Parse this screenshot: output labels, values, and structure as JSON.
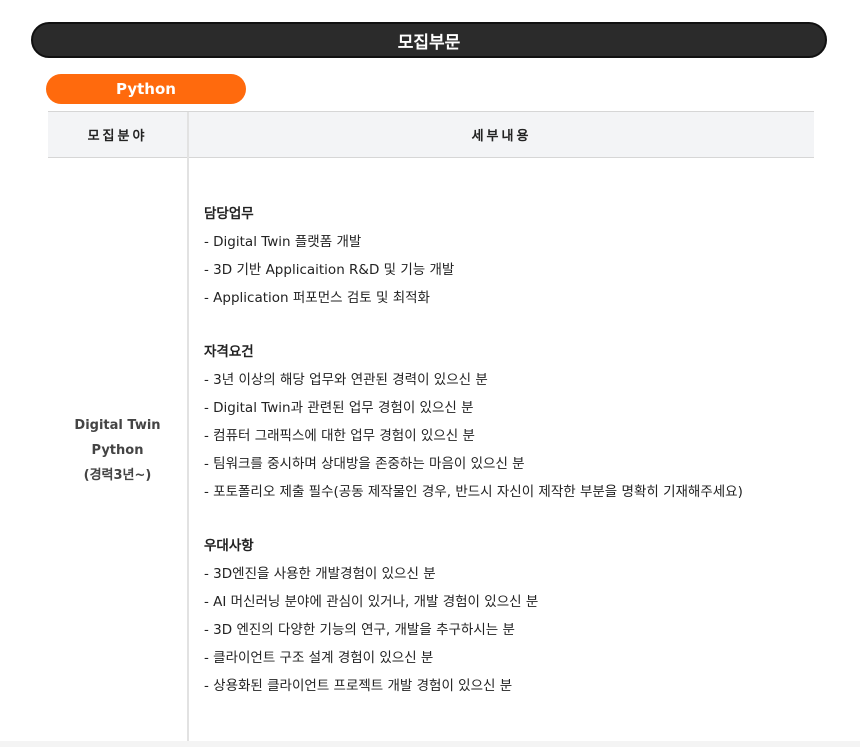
{
  "header": {
    "title": "모집부문"
  },
  "category_pill": {
    "label": "Python"
  },
  "table": {
    "columns": [
      "모집분야",
      "세부내용"
    ],
    "field_lines": [
      "Digital Twin",
      "Python",
      "(경력3년~)"
    ],
    "sections": [
      {
        "title": "담당업무",
        "items": [
          "- Digital Twin 플랫폼 개발",
          "- 3D 기반 Applicaition R&D 및 기능 개발",
          "- Application 퍼포먼스 검토 및 최적화"
        ]
      },
      {
        "title": "자격요건",
        "items": [
          "- 3년 이상의 해당 업무와 연관된 경력이 있으신 분",
          "- Digital Twin과 관련된 업무 경험이 있으신 분",
          "- 컴퓨터 그래픽스에 대한 업무 경험이 있으신 분",
          "- 팀워크를 중시하며 상대방을 존중하는 마음이 있으신 분",
          "- 포토폴리오 제출 필수(공동 제작물인 경우, 반드시 자신이 제작한 부분을 명확히 기재해주세요)"
        ]
      },
      {
        "title": "우대사항",
        "items": [
          "- 3D엔진을 사용한 개발경험이 있으신 분",
          "- AI 머신러닝 분야에 관심이 있거나, 개발 경험이 있으신 분",
          "- 3D 엔진의 다양한 기능의 연구, 개발을 추구하시는 분",
          "- 클라이언트 구조 설계 경험이 있으신 분",
          "- 상용화된 클라이언트 프로젝트 개발 경험이 있으신 분"
        ]
      }
    ]
  },
  "colors": {
    "header_bg": "#2b2b2b",
    "accent": "#ff6a0d",
    "table_head_bg": "#f3f4f6"
  }
}
